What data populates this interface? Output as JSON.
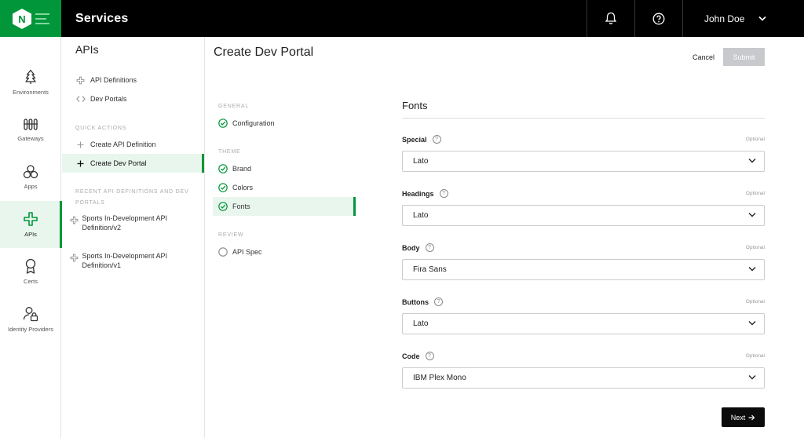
{
  "app": {
    "title": "Services",
    "logo_letter": "N",
    "brand_color": "#009639"
  },
  "topbar": {
    "user_name": "John Doe",
    "icons": [
      "bell-icon",
      "help-icon",
      "chevron-down-icon"
    ]
  },
  "rail": {
    "items": [
      {
        "label": "Environments",
        "icon": "tree-icon",
        "active": false
      },
      {
        "label": "Gateways",
        "icon": "gateway-icon",
        "active": false
      },
      {
        "label": "Apps",
        "icon": "apps-icon",
        "active": false
      },
      {
        "label": "APIs",
        "icon": "api-icon",
        "active": true
      },
      {
        "label": "Certs",
        "icon": "cert-icon",
        "active": false
      },
      {
        "label": "Identity Providers",
        "icon": "identity-icon",
        "active": false
      }
    ]
  },
  "panel": {
    "title": "APIs",
    "items": [
      {
        "label": "API Definitions",
        "icon": "api-icon"
      },
      {
        "label": "Dev Portals",
        "icon": "code-icon"
      }
    ],
    "quick_actions_label": "QUICK ACTIONS",
    "quick_actions": [
      {
        "label": "Create API Definition",
        "icon": "plus-icon",
        "active": false
      },
      {
        "label": "Create Dev Portal",
        "icon": "plus-icon",
        "active": true
      }
    ],
    "recent_label": "RECENT API DEFINITIONS AND DEV PORTALS",
    "recent": [
      {
        "label": "Sports In-Development API Definition/v2"
      },
      {
        "label": "Sports In-Development API Definition/v1"
      }
    ]
  },
  "main": {
    "title": "Create Dev Portal",
    "cancel_label": "Cancel",
    "submit_label": "Submit",
    "steps": {
      "general_label": "GENERAL",
      "theme_label": "THEME",
      "review_label": "REVIEW",
      "configuration": "Configuration",
      "brand": "Brand",
      "colors": "Colors",
      "fonts": "Fonts",
      "api_spec": "API Spec"
    },
    "section_title": "Fonts",
    "optional_label": "Optional",
    "fields": [
      {
        "label": "Special",
        "value": "Lato"
      },
      {
        "label": "Headings",
        "value": "Lato"
      },
      {
        "label": "Body",
        "value": "Fira Sans"
      },
      {
        "label": "Buttons",
        "value": "Lato"
      },
      {
        "label": "Code",
        "value": "IBM Plex Mono"
      }
    ],
    "next_label": "Next",
    "help_glyph": "?"
  }
}
